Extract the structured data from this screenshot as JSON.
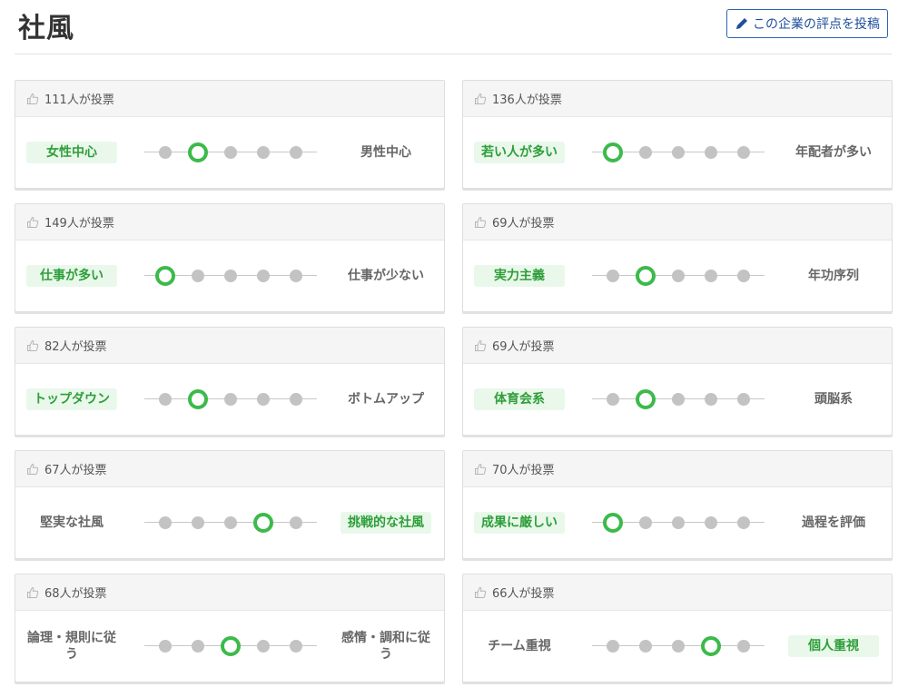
{
  "header": {
    "title": "社風",
    "post_button_label": "この企業の評点を投稿"
  },
  "colors": {
    "accent_green": "#3cba4a",
    "active_label_bg": "#e9f8ea",
    "button_blue": "#1f4f9c"
  },
  "icons": {
    "vote": "thumbs-up-icon",
    "post": "pencil-icon"
  },
  "cards": [
    {
      "votes": "111人が投票",
      "left": "女性中心",
      "right": "男性中心",
      "selected": 2,
      "active": "left"
    },
    {
      "votes": "136人が投票",
      "left": "若い人が多い",
      "right": "年配者が多い",
      "selected": 1,
      "active": "left"
    },
    {
      "votes": "149人が投票",
      "left": "仕事が多い",
      "right": "仕事が少ない",
      "selected": 1,
      "active": "left"
    },
    {
      "votes": "69人が投票",
      "left": "実力主義",
      "right": "年功序列",
      "selected": 2,
      "active": "left"
    },
    {
      "votes": "82人が投票",
      "left": "トップダウン",
      "right": "ボトムアップ",
      "selected": 2,
      "active": "left"
    },
    {
      "votes": "69人が投票",
      "left": "体育会系",
      "right": "頭脳系",
      "selected": 2,
      "active": "left"
    },
    {
      "votes": "67人が投票",
      "left": "堅実な社風",
      "right": "挑戦的な社風",
      "selected": 4,
      "active": "right"
    },
    {
      "votes": "70人が投票",
      "left": "成果に厳しい",
      "right": "過程を評価",
      "selected": 1,
      "active": "left"
    },
    {
      "votes": "68人が投票",
      "left": "論理・規則に従う",
      "right": "感情・調和に従う",
      "selected": 3,
      "active": "none"
    },
    {
      "votes": "66人が投票",
      "left": "チーム重視",
      "right": "個人重視",
      "selected": 4,
      "active": "right"
    }
  ],
  "scale_points": 5
}
